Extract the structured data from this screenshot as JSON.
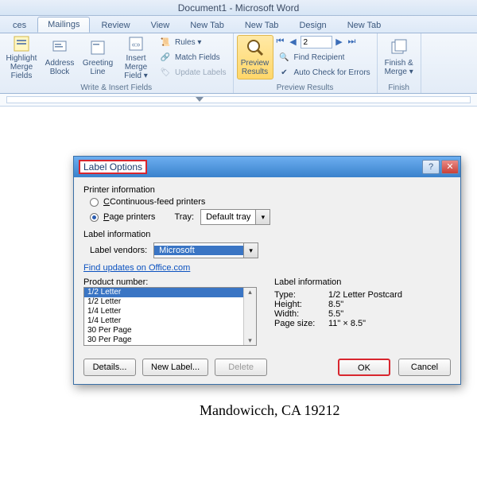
{
  "window": {
    "title": "Document1 - Microsoft Word"
  },
  "tabs": {
    "partial": "ces",
    "active": "Mailings",
    "t1": "Review",
    "t2": "View",
    "t3": "New Tab",
    "t4": "New Tab",
    "t5": "Design",
    "t6": "New Tab"
  },
  "ribbon": {
    "highlight": "Highlight\nMerge Fields",
    "address": "Address\nBlock",
    "greeting": "Greeting\nLine",
    "insertmerge": "Insert Merge\nField ▾",
    "rules": "Rules ▾",
    "match": "Match Fields",
    "update": "Update Labels",
    "groupA": "Write & Insert Fields",
    "preview": "Preview\nResults",
    "recno": "2",
    "findrec": "Find Recipient",
    "autocheck": "Auto Check for Errors",
    "groupB": "Preview Results",
    "finish": "Finish &\nMerge ▾",
    "groupC": "Finish"
  },
  "dialog": {
    "title": "Label Options",
    "help": "?",
    "close": "✕",
    "printerinfo": "Printer information",
    "contfeed": "Continuous-feed printers",
    "pageprinters": "Page printers",
    "tray": "Tray:",
    "trayval": "Default tray",
    "labelinfo": "Label information",
    "vendors": "Label vendors:",
    "vendorval": "Microsoft",
    "link": "Find updates on Office.com",
    "prodnum": "Product number:",
    "list": {
      "i0": "1/2 Letter",
      "i1": "1/2 Letter",
      "i2": "1/4 Letter",
      "i3": "1/4 Letter",
      "i4": "30 Per Page",
      "i5": "30 Per Page"
    },
    "info": {
      "head": "Label information",
      "type_k": "Type:",
      "type_v": "1/2 Letter Postcard",
      "height_k": "Height:",
      "height_v": "8.5\"",
      "width_k": "Width:",
      "width_v": "5.5\"",
      "page_k": "Page size:",
      "page_v": "11\" × 8.5\""
    },
    "details": "Details...",
    "newlabel": "New Label...",
    "delete": "Delete",
    "ok": "OK",
    "cancel": "Cancel"
  },
  "doc": {
    "line": "Mandowicch, CA 19212"
  }
}
